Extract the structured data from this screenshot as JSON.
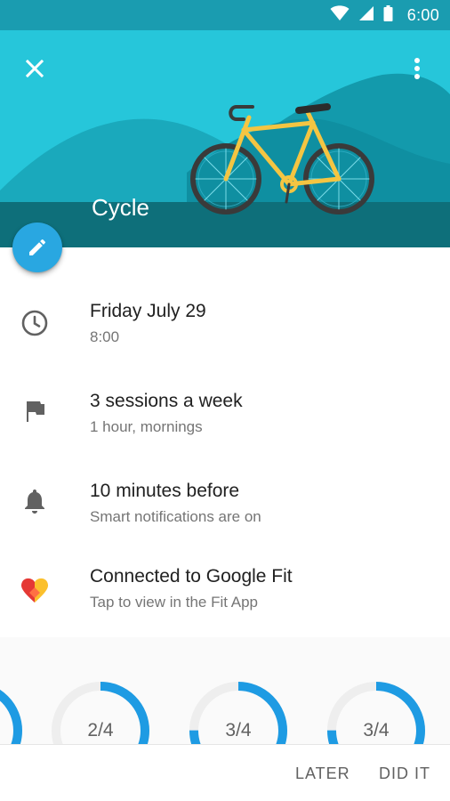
{
  "status_bar": {
    "time": "6:00"
  },
  "header": {
    "title": "Cycle"
  },
  "details": [
    {
      "icon": "clock-icon",
      "title": "Friday July 29",
      "subtitle": "8:00"
    },
    {
      "icon": "flag-icon",
      "title": "3 sessions a week",
      "subtitle": "1 hour, mornings"
    },
    {
      "icon": "bell-icon",
      "title": "10 minutes before",
      "subtitle": "Smart notifications are on"
    },
    {
      "icon": "google-fit-heart-icon",
      "title": "Connected to Google Fit",
      "subtitle": "Tap to view in the Fit App"
    }
  ],
  "progress": [
    {
      "label": "2/4",
      "fraction": 0.5
    },
    {
      "label": "3/4",
      "fraction": 0.75
    },
    {
      "label": "3/4",
      "fraction": 0.75
    }
  ],
  "actions": {
    "later": "LATER",
    "did_it": "DID IT"
  },
  "colors": {
    "status_bar": "#1a9cb0",
    "hero": "#26c6da",
    "fab": "#29a7e1",
    "ring": "#1e9be3",
    "ring_track": "#eeeeee"
  }
}
